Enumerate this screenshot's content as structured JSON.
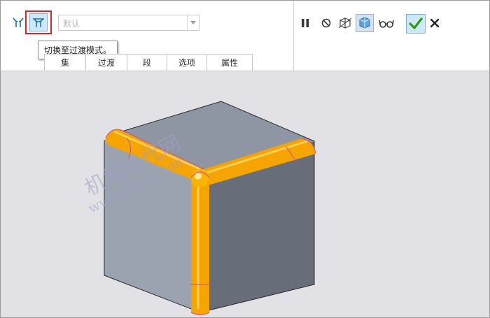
{
  "toolbar": {
    "set_mode_icon": "set-mode-icon",
    "transition_mode_icon": "transition-mode-icon",
    "dropdown_value": "默认",
    "tooltip": "切换至过渡模式。"
  },
  "tabs": [
    {
      "label": "集"
    },
    {
      "label": "过渡"
    },
    {
      "label": "段"
    },
    {
      "label": "选项"
    },
    {
      "label": "属性"
    }
  ],
  "right_tools": {
    "pause": "pause-icon",
    "stop": "no-entry-icon",
    "preview_off": "preview-geometry-icon",
    "preview_on": "verify-mode-icon",
    "glasses": "glasses-icon",
    "ok": "checkmark-icon",
    "cancel": "close-icon"
  },
  "watermark": {
    "line1": "机械时代网",
    "line2": "www.jxage.com"
  },
  "colors": {
    "accent_red": "#e02020",
    "round_orange": "#f5a000",
    "cube_light": "#9aa2b0",
    "cube_dark": "#6b717d",
    "ok_green": "#2f9a1a"
  }
}
